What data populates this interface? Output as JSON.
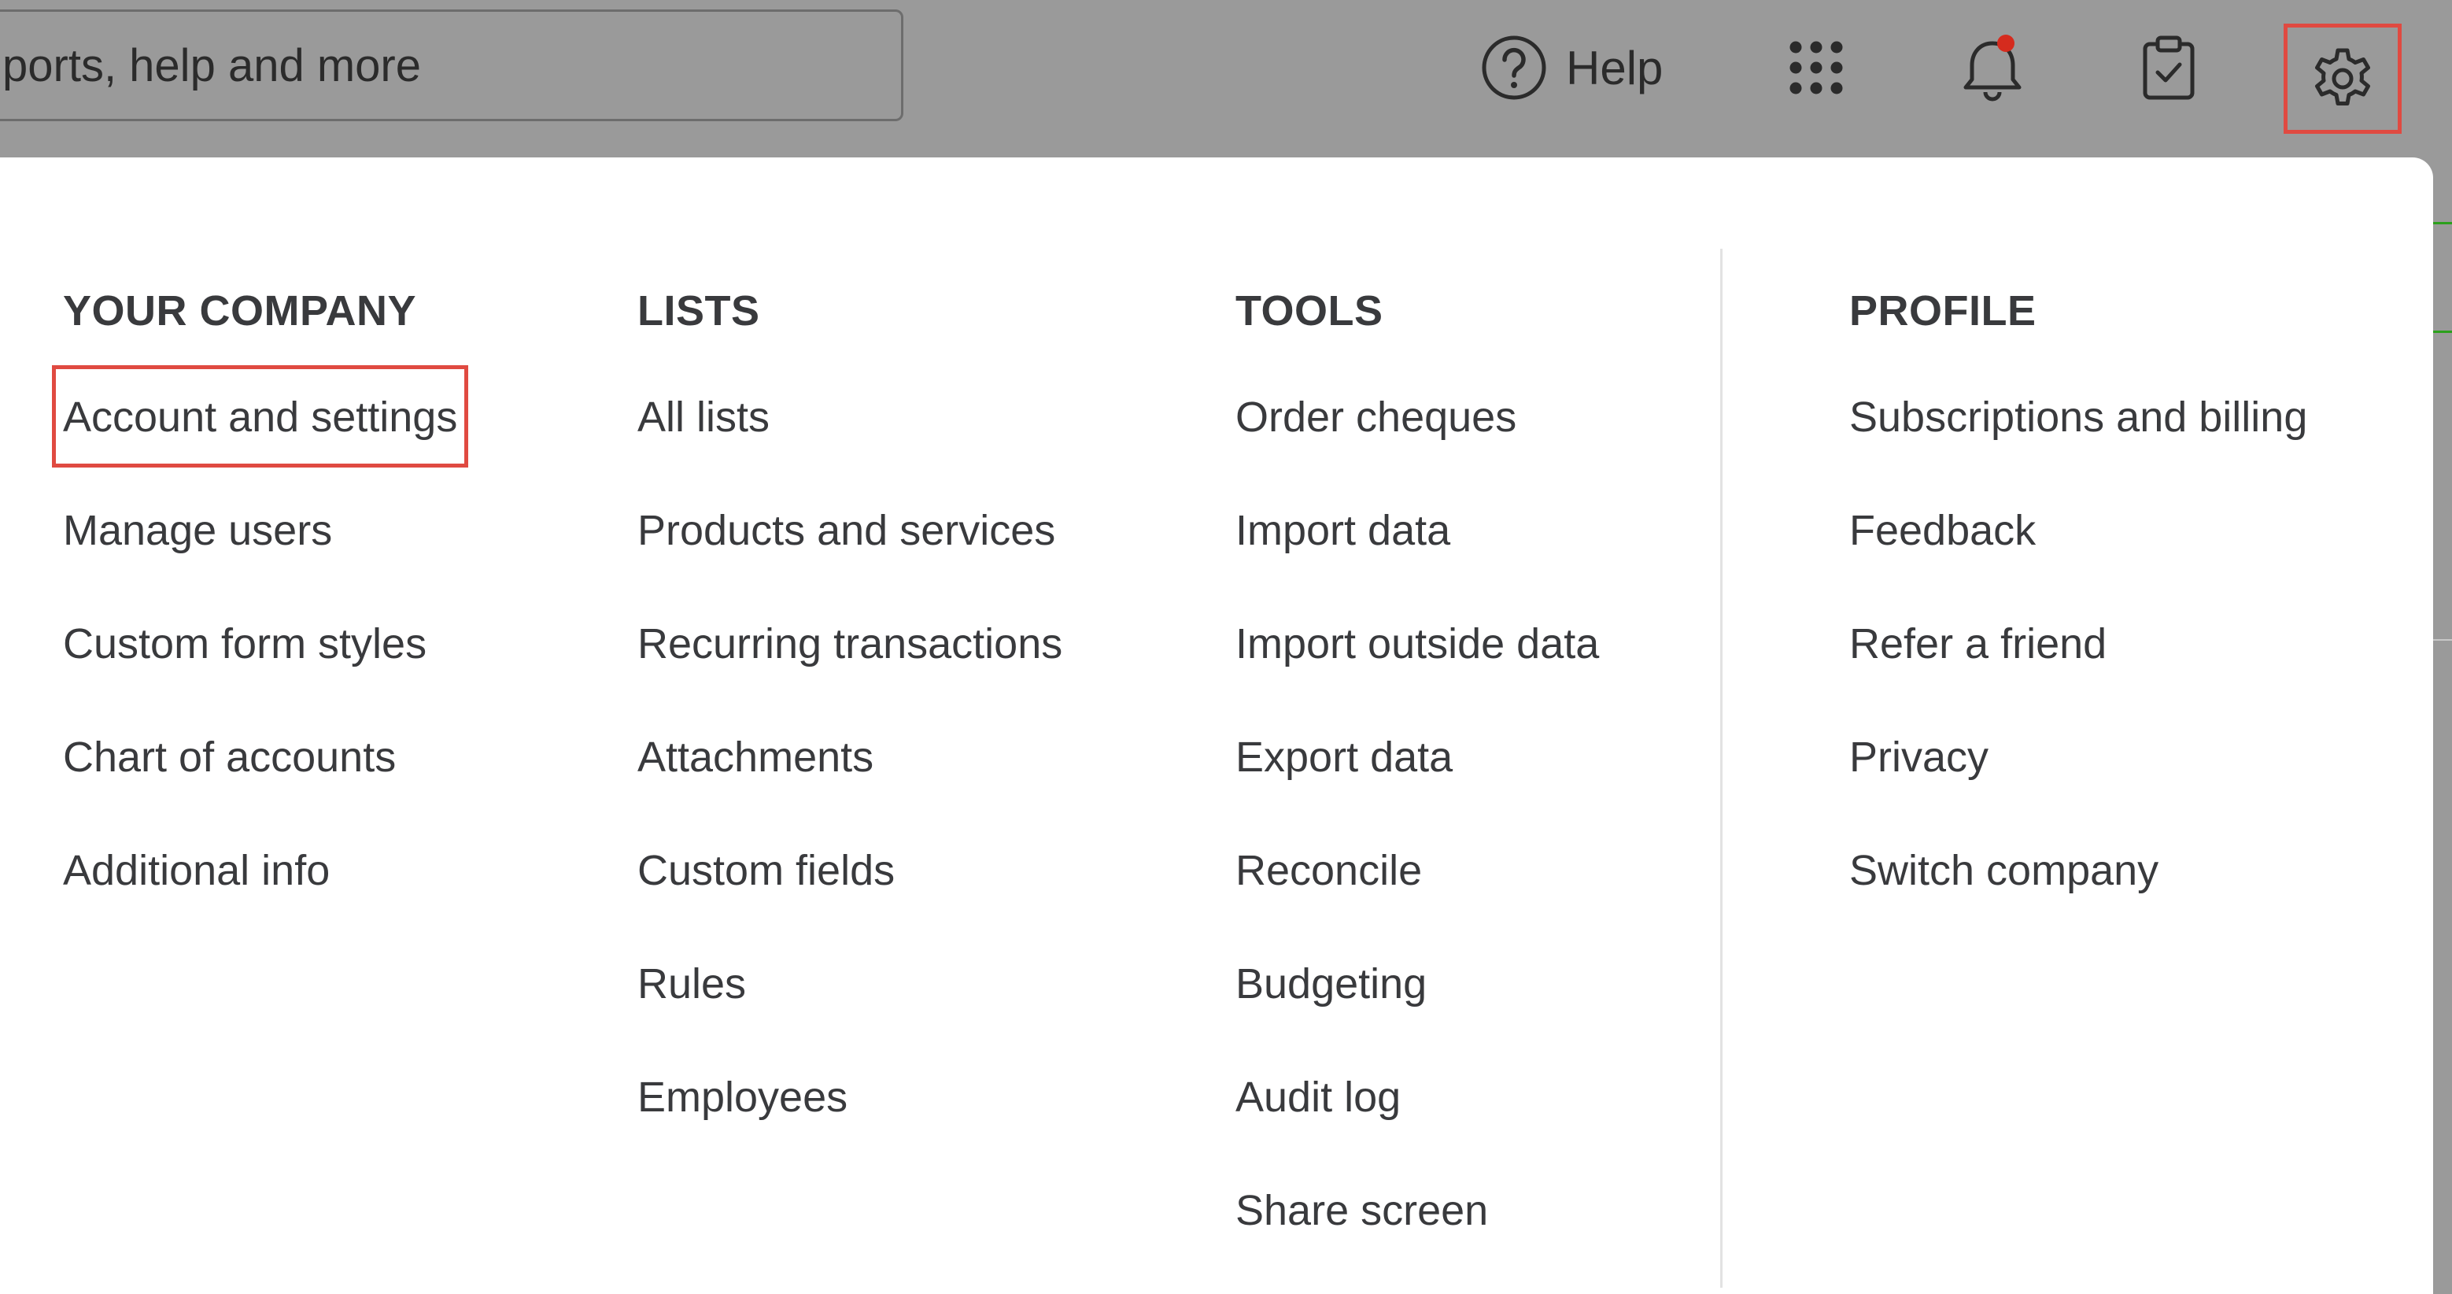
{
  "search": {
    "placeholder": "Search transactions, reports, help and more",
    "value": "ports, help and more"
  },
  "header": {
    "help_label": "Help"
  },
  "icons": {
    "help": "help-circle-icon",
    "apps": "grid-dots-icon",
    "notifications": "bell-icon",
    "tasks": "clipboard-check-icon",
    "settings": "gear-icon"
  },
  "menu": {
    "columns": [
      {
        "heading": "YOUR COMPANY",
        "items": [
          "Account and settings",
          "Manage users",
          "Custom form styles",
          "Chart of accounts",
          "Additional info"
        ]
      },
      {
        "heading": "LISTS",
        "items": [
          "All lists",
          "Products and services",
          "Recurring transactions",
          "Attachments",
          "Custom fields",
          "Rules",
          "Employees"
        ]
      },
      {
        "heading": "TOOLS",
        "items": [
          "Order cheques",
          "Import data",
          "Import outside data",
          "Export data",
          "Reconcile",
          "Budgeting",
          "Audit log",
          "Share screen"
        ]
      },
      {
        "heading": "PROFILE",
        "items": [
          "Subscriptions and billing",
          "Feedback",
          "Refer a friend",
          "Privacy",
          "Switch company"
        ]
      }
    ]
  },
  "colors": {
    "highlight": "#e04a41",
    "overlay": "#9a9a9a",
    "text": "#393a3d",
    "notification_dot": "#d52b1e",
    "accent_green": "#2ca01c"
  }
}
